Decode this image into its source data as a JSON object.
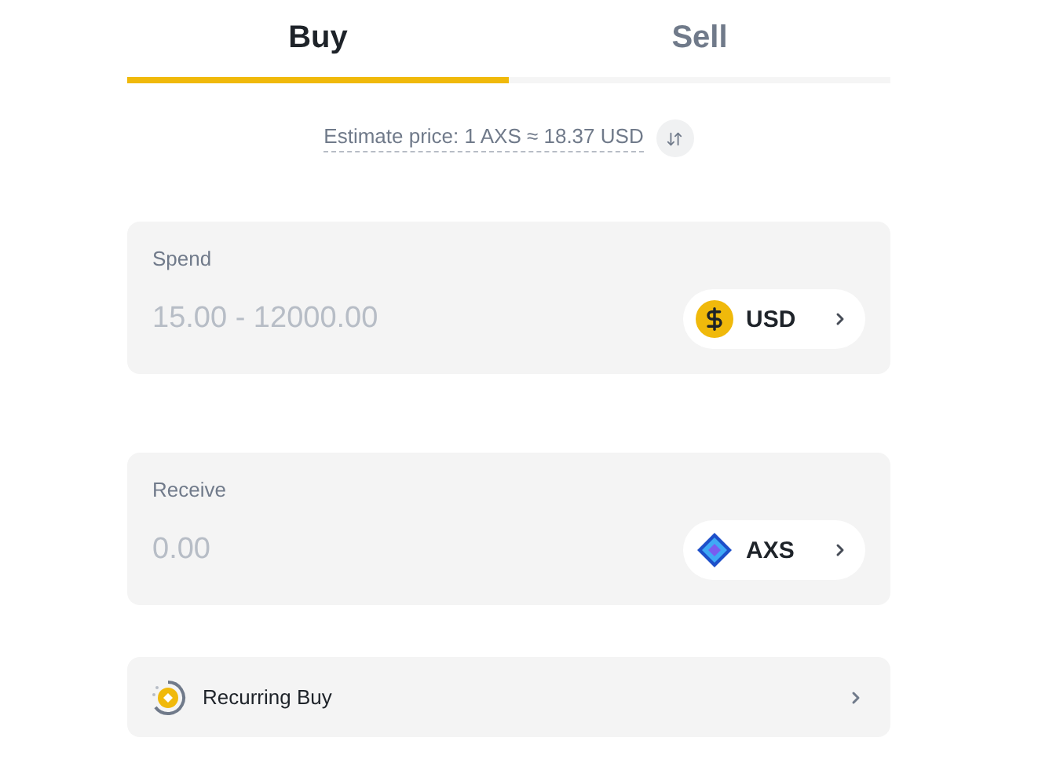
{
  "tabs": [
    {
      "label": "Buy",
      "selected": true
    },
    {
      "label": "Sell",
      "selected": false
    }
  ],
  "estimate": {
    "text": "Estimate price: 1 AXS ≈ 18.37 USD"
  },
  "fields": [
    {
      "label": "Spend",
      "placeholder": "15.00 - 12000.00",
      "asset": {
        "code": "USD",
        "kind": "usd"
      }
    },
    {
      "label": "Receive",
      "placeholder": "0.00",
      "asset": {
        "code": "AXS",
        "kind": "axs"
      }
    }
  ],
  "recurring": {
    "label": "Recurring Buy"
  }
}
